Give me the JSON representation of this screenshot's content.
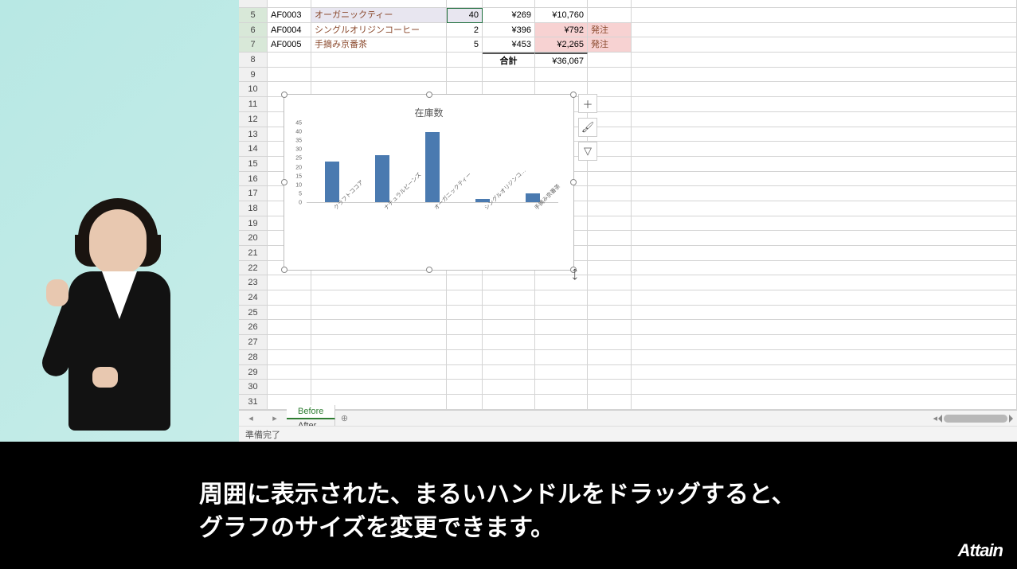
{
  "table": {
    "rows": [
      {
        "n": 5,
        "a": "AF0003",
        "b": "オーガニックティー",
        "c": "40",
        "d": "¥269",
        "e": "¥10,760",
        "f": "",
        "lav": true
      },
      {
        "n": 6,
        "a": "AF0004",
        "b": "シングルオリジンコーヒー",
        "c": "2",
        "d": "¥396",
        "e": "¥792",
        "f": "発注",
        "peach": true
      },
      {
        "n": 7,
        "a": "AF0005",
        "b": "手摘み京番茶",
        "c": "5",
        "d": "¥453",
        "e": "¥2,265",
        "f": "発注",
        "peach": true
      }
    ],
    "total_row": {
      "n": 8,
      "label": "合計",
      "value": "¥36,067"
    },
    "blank_rows_start": 9,
    "blank_rows_end": 31
  },
  "chart_data": {
    "type": "bar",
    "title": "在庫数",
    "categories": [
      "クラフトココア",
      "ナチュラルビーンズ",
      "オーガニックティー",
      "シングルオリジンコ…",
      "手摘み京番茶"
    ],
    "values": [
      23,
      27,
      40,
      2,
      5
    ],
    "ylim": [
      0,
      45
    ],
    "yticks": [
      0,
      5,
      10,
      15,
      20,
      25,
      30,
      35,
      40,
      45
    ]
  },
  "side_buttons": {
    "add": "＋",
    "brush": "🖌",
    "filter": "▽"
  },
  "tabs": {
    "items": [
      "Before",
      "After"
    ],
    "active": 0,
    "add": "⊕"
  },
  "status": "準備完了",
  "subtitle": {
    "line1": "周囲に表示された、まるいハンドルをドラッグすると、",
    "line2": "グラフのサイズを変更できます。"
  },
  "logo": "Attain",
  "first_visible_row": 4
}
